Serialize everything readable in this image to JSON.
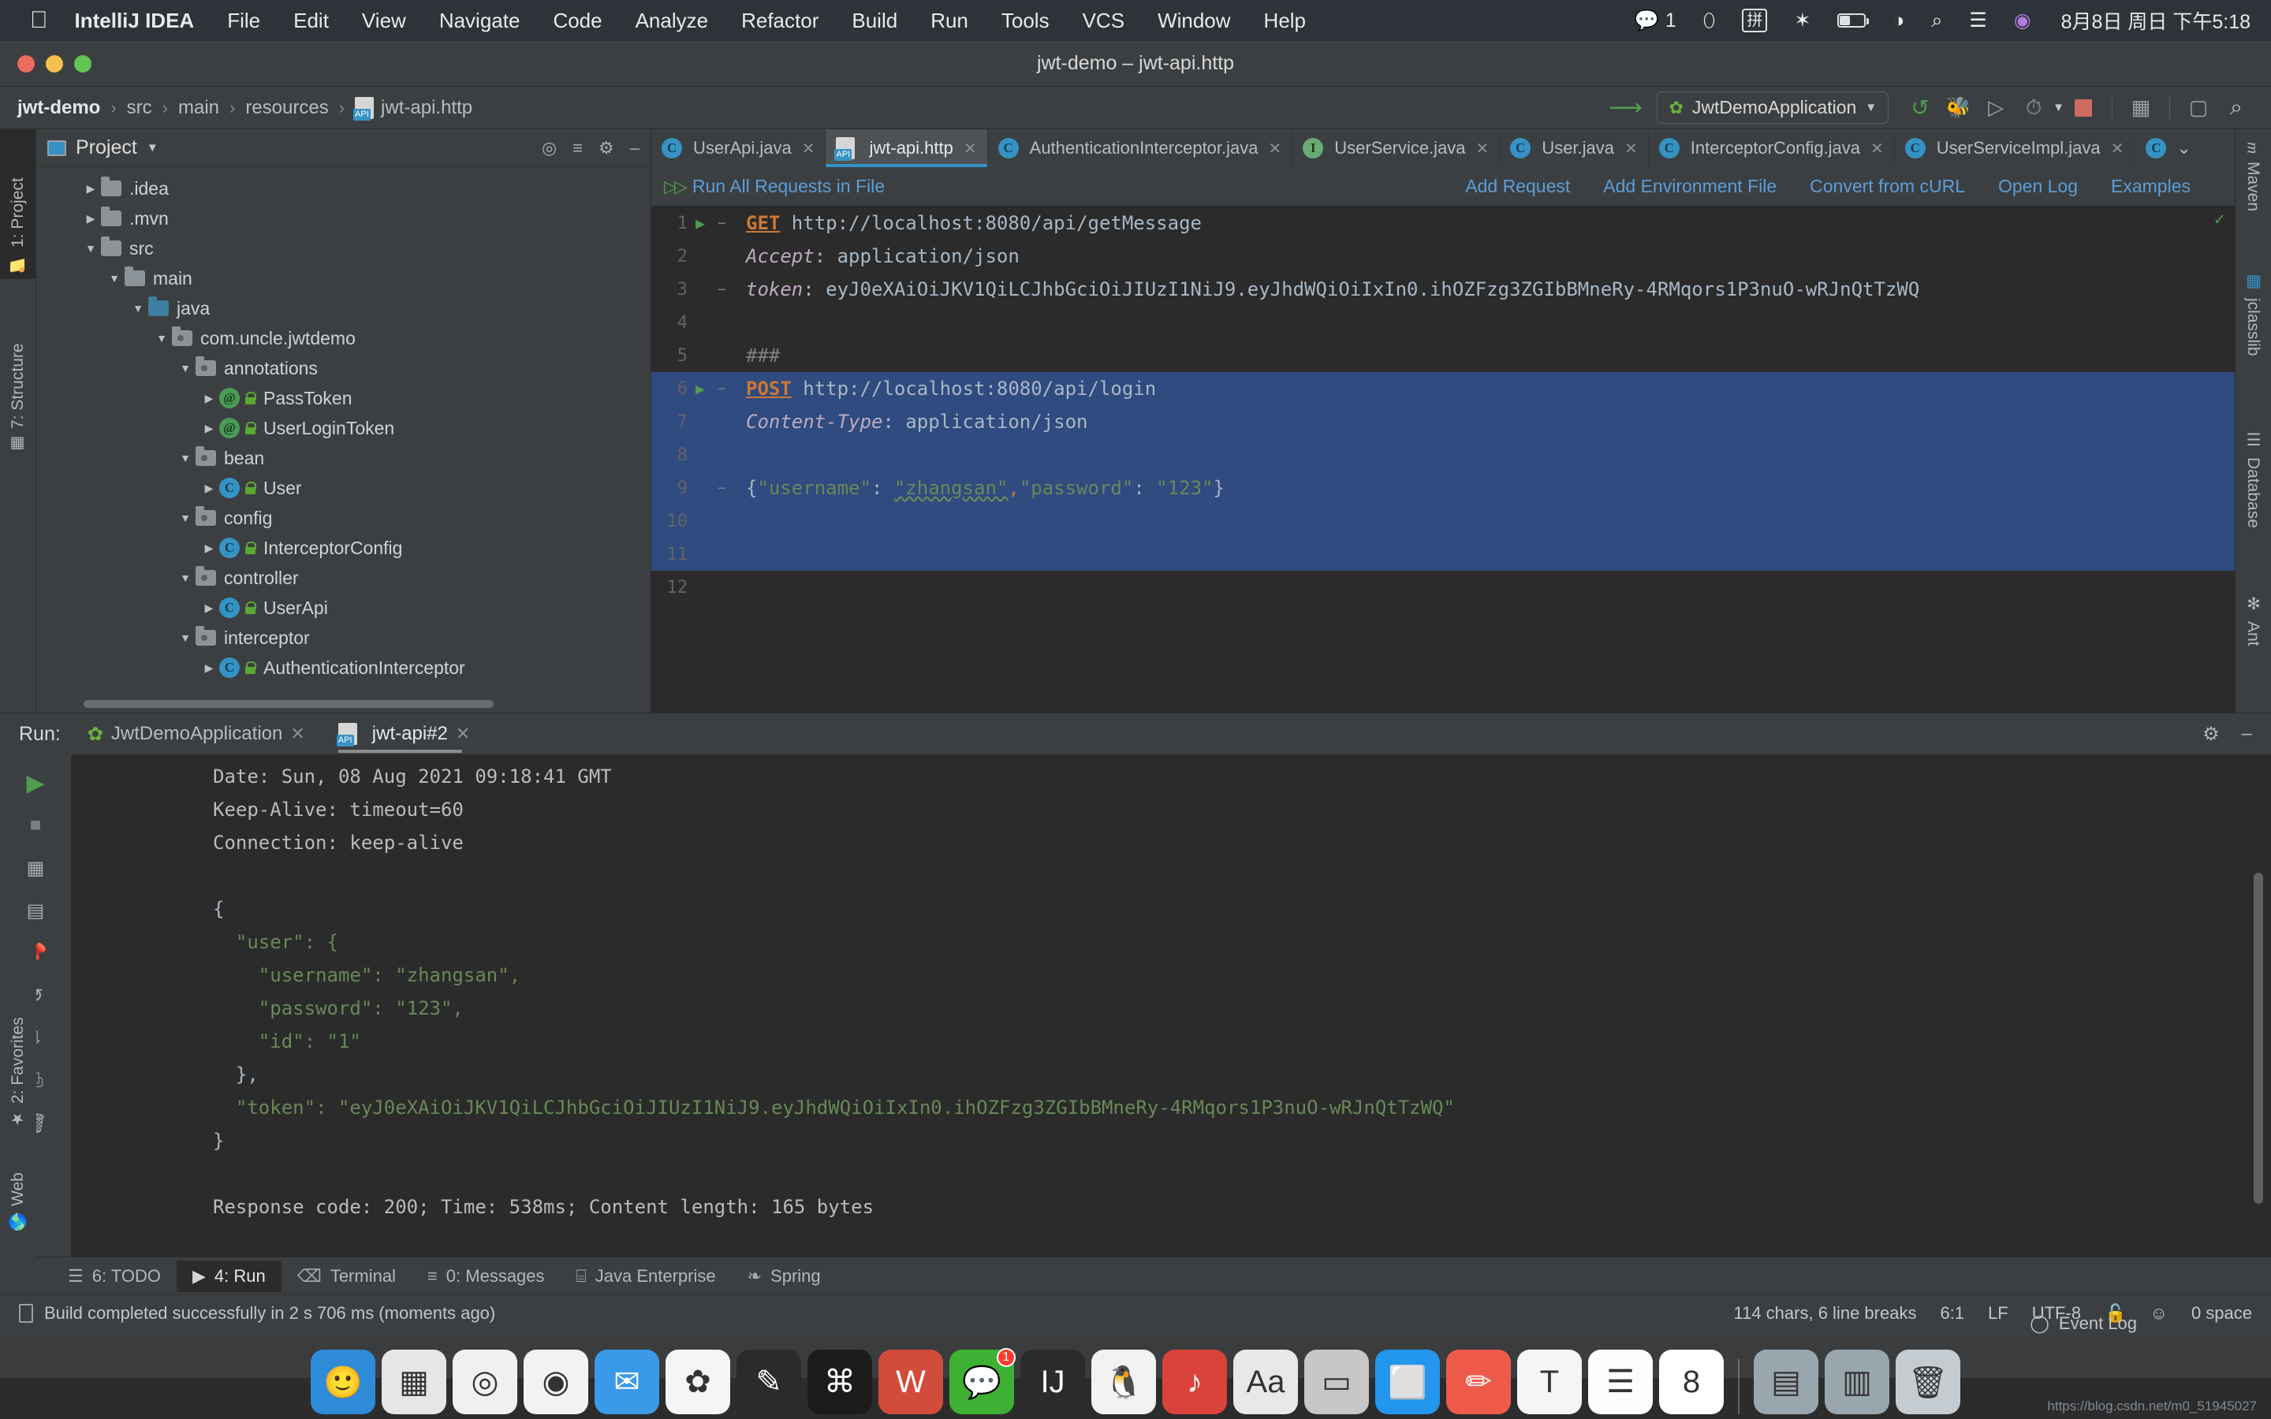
{
  "menubar": {
    "apple_icon": "apple-logo-icon",
    "items": [
      {
        "label": "IntelliJ IDEA",
        "bold": true
      },
      {
        "label": "File",
        "bold": false
      },
      {
        "label": "Edit",
        "bold": false
      },
      {
        "label": "View",
        "bold": false
      },
      {
        "label": "Navigate",
        "bold": false
      },
      {
        "label": "Code",
        "bold": false
      },
      {
        "label": "Analyze",
        "bold": false
      },
      {
        "label": "Refactor",
        "bold": false
      },
      {
        "label": "Build",
        "bold": false
      },
      {
        "label": "Run",
        "bold": false
      },
      {
        "label": "Tools",
        "bold": false
      },
      {
        "label": "VCS",
        "bold": false
      },
      {
        "label": "Window",
        "bold": false
      },
      {
        "label": "Help",
        "bold": false
      }
    ],
    "status_icons": [
      {
        "name": "wechat-icon",
        "glyph": "💬",
        "badge": "1"
      },
      {
        "name": "shield-icon",
        "glyph": "⬯"
      },
      {
        "name": "input-method-icon",
        "glyph": "拼"
      },
      {
        "name": "bluetooth-icon",
        "glyph": "✶"
      },
      {
        "name": "battery-icon",
        "glyph": ""
      },
      {
        "name": "wifi-icon",
        "glyph": "◔"
      },
      {
        "name": "search-icon",
        "glyph": "⌕"
      },
      {
        "name": "control-center-icon",
        "glyph": "☰"
      },
      {
        "name": "siri-icon",
        "glyph": "◉"
      }
    ],
    "clock": "8月8日 周日 下午5:18"
  },
  "window": {
    "title": "jwt-demo – jwt-api.http",
    "traffic_lights": [
      "close",
      "minimize",
      "zoom"
    ]
  },
  "navbar": {
    "breadcrumbs": [
      "jwt-demo",
      "src",
      "main",
      "resources",
      "jwt-api.http"
    ],
    "separator": "›",
    "run_config": "JwtDemoApplication",
    "toolbar_icons": [
      "back-arrow-icon",
      "rerun-icon",
      "debug-icon",
      "run-with-coverage-icon",
      "profiler-icon",
      "stop-icon",
      "build-project-icon",
      "open-terminal-icon",
      "search-everywhere-icon"
    ]
  },
  "left_strip": {
    "tabs": [
      {
        "label": "1: Project",
        "icon": "project-folder-icon",
        "active": true
      },
      {
        "label": "7: Structure",
        "icon": "structure-icon",
        "active": false
      },
      {
        "label": "2: Favorites",
        "icon": "star-icon",
        "active": false
      },
      {
        "label": "Web",
        "icon": "globe-icon",
        "active": false
      }
    ]
  },
  "right_strip": {
    "tabs": [
      {
        "label": "Maven",
        "icon": "maven-icon"
      },
      {
        "label": "jclasslib",
        "icon": "jclasslib-icon"
      },
      {
        "label": "Database",
        "icon": "database-icon"
      },
      {
        "label": "Ant",
        "icon": "ant-icon"
      }
    ]
  },
  "project_panel": {
    "title": "Project",
    "header_icons": [
      "locate-icon",
      "collapse-all-icon",
      "settings-gear-icon",
      "hide-icon"
    ],
    "tree": [
      {
        "label": ".idea",
        "indent": 1,
        "arrow": "▶",
        "kind": "folder"
      },
      {
        "label": ".mvn",
        "indent": 1,
        "arrow": "▶",
        "kind": "folder"
      },
      {
        "label": "src",
        "indent": 1,
        "arrow": "▼",
        "kind": "folder"
      },
      {
        "label": "main",
        "indent": 2,
        "arrow": "▼",
        "kind": "folder"
      },
      {
        "label": "java",
        "indent": 3,
        "arrow": "▼",
        "kind": "folder-source"
      },
      {
        "label": "com.uncle.jwtdemo",
        "indent": 4,
        "arrow": "▼",
        "kind": "package"
      },
      {
        "label": "annotations",
        "indent": 5,
        "arrow": "▼",
        "kind": "package"
      },
      {
        "label": "PassToken",
        "indent": 6,
        "arrow": "▶",
        "kind": "annotation"
      },
      {
        "label": "UserLoginToken",
        "indent": 6,
        "arrow": "▶",
        "kind": "annotation"
      },
      {
        "label": "bean",
        "indent": 5,
        "arrow": "▼",
        "kind": "package"
      },
      {
        "label": "User",
        "indent": 6,
        "arrow": "▶",
        "kind": "class"
      },
      {
        "label": "config",
        "indent": 5,
        "arrow": "▼",
        "kind": "package"
      },
      {
        "label": "InterceptorConfig",
        "indent": 6,
        "arrow": "▶",
        "kind": "class"
      },
      {
        "label": "controller",
        "indent": 5,
        "arrow": "▼",
        "kind": "package"
      },
      {
        "label": "UserApi",
        "indent": 6,
        "arrow": "▶",
        "kind": "class"
      },
      {
        "label": "interceptor",
        "indent": 5,
        "arrow": "▼",
        "kind": "package"
      },
      {
        "label": "AuthenticationInterceptor",
        "indent": 6,
        "arrow": "▶",
        "kind": "class"
      }
    ]
  },
  "editor": {
    "tabs": [
      {
        "label": "UserApi.java",
        "icon": "class-icon",
        "active": false
      },
      {
        "label": "jwt-api.http",
        "icon": "http-file-icon",
        "active": true
      },
      {
        "label": "AuthenticationInterceptor.java",
        "icon": "class-icon",
        "active": false
      },
      {
        "label": "UserService.java",
        "icon": "interface-icon",
        "active": false
      },
      {
        "label": "User.java",
        "icon": "class-icon",
        "active": false
      },
      {
        "label": "InterceptorConfig.java",
        "icon": "class-icon",
        "active": false
      },
      {
        "label": "UserServiceImpl.java",
        "icon": "class-icon",
        "active": false
      }
    ],
    "tab_overflow_icon": "chevron-down-icon",
    "http_toolbar": {
      "run_all": "Run All Requests in File",
      "links": [
        "Add Request",
        "Add Environment File",
        "Convert from cURL",
        "Open Log",
        "Examples"
      ]
    },
    "lines": [
      {
        "num": "1",
        "selected": false,
        "runmark": true,
        "fold": "−",
        "segments": [
          {
            "t": "GET",
            "c": "kw-method"
          },
          {
            "t": " http://localhost:8080/api/getMessage",
            "c": "punc"
          }
        ]
      },
      {
        "num": "2",
        "selected": false,
        "runmark": false,
        "fold": "",
        "segments": [
          {
            "t": "Accept",
            "c": "hdr-name"
          },
          {
            "t": ": application/json",
            "c": "punc"
          }
        ]
      },
      {
        "num": "3",
        "selected": false,
        "runmark": false,
        "fold": "−",
        "segments": [
          {
            "t": "token",
            "c": "hdr-name"
          },
          {
            "t": ": eyJ0eXAiOiJKV1QiLCJhbGciOiJIUzI1NiJ9.eyJhdWQiOiIxIn0.ihOZFzg3ZGIbBMneRy-4RMqors1P3nuO-wRJnQtTzWQ",
            "c": "punc"
          }
        ]
      },
      {
        "num": "4",
        "selected": false,
        "runmark": false,
        "fold": "",
        "segments": []
      },
      {
        "num": "5",
        "selected": false,
        "runmark": false,
        "fold": "",
        "segments": [
          {
            "t": "###",
            "c": "cmt"
          }
        ]
      },
      {
        "num": "6",
        "selected": true,
        "runmark": true,
        "fold": "−",
        "segments": [
          {
            "t": "POST",
            "c": "kw-method"
          },
          {
            "t": " http://localhost:8080/api/login",
            "c": "punc"
          }
        ]
      },
      {
        "num": "7",
        "selected": true,
        "runmark": false,
        "fold": "",
        "segments": [
          {
            "t": "Content-Type",
            "c": "hdr-name"
          },
          {
            "t": ": application/json",
            "c": "punc"
          }
        ]
      },
      {
        "num": "8",
        "selected": true,
        "runmark": false,
        "fold": "",
        "segments": []
      },
      {
        "num": "9",
        "selected": true,
        "runmark": false,
        "fold": "−",
        "segments": [
          {
            "t": "{",
            "c": "punc"
          },
          {
            "t": "\"username\"",
            "c": "str"
          },
          {
            "t": ": ",
            "c": "punc"
          },
          {
            "t": "\"zhangsan\"",
            "c": "strg squig"
          },
          {
            "t": ",",
            "c": "orange"
          },
          {
            "t": "\"password\"",
            "c": "str"
          },
          {
            "t": ": ",
            "c": "punc"
          },
          {
            "t": "\"123\"",
            "c": "strg"
          },
          {
            "t": "}",
            "c": "punc"
          }
        ]
      },
      {
        "num": "10",
        "selected": true,
        "runmark": false,
        "fold": "",
        "segments": []
      },
      {
        "num": "11",
        "selected": true,
        "runmark": false,
        "fold": "",
        "segments": []
      },
      {
        "num": "12",
        "selected": false,
        "runmark": false,
        "fold": "",
        "segments": []
      }
    ]
  },
  "run_panel": {
    "label": "Run:",
    "tabs": [
      {
        "label": "JwtDemoApplication",
        "icon": "spring-leaf-icon",
        "active": false
      },
      {
        "label": "jwt-api#2",
        "icon": "http-file-icon",
        "active": true
      }
    ],
    "header_icons": [
      "settings-gear-icon",
      "hide-icon"
    ],
    "tool_icons": [
      "rerun-icon",
      "stop-icon",
      "restore-layout-icon",
      "layout-icon",
      "pin-icon",
      "soft-wrap-icon",
      "scroll-to-end-icon",
      "print-icon",
      "clear-all-icon"
    ],
    "console": [
      {
        "text": "Date: Sun, 08 Aug 2021 09:18:41 GMT",
        "style": "plain"
      },
      {
        "text": "Keep-Alive: timeout=60",
        "style": "plain"
      },
      {
        "text": "Connection: keep-alive",
        "style": "plain"
      },
      {
        "text": "",
        "style": "plain"
      },
      {
        "text": "{",
        "style": "brace"
      },
      {
        "text": "  \"user\": {",
        "style": "key"
      },
      {
        "text": "    \"username\": \"zhangsan\",",
        "style": "key"
      },
      {
        "text": "    \"password\": \"123\",",
        "style": "key"
      },
      {
        "text": "    \"id\": \"1\"",
        "style": "key"
      },
      {
        "text": "  },",
        "style": "brace"
      },
      {
        "text": "  \"token\": \"eyJ0eXAiOiJKV1QiLCJhbGciOiJIUzI1NiJ9.eyJhdWQiOiIxIn0.ihOZFzg3ZGIbBMneRy-4RMqors1P3nuO-wRJnQtTzWQ\"",
        "style": "key"
      },
      {
        "text": "}",
        "style": "brace"
      },
      {
        "text": "",
        "style": "plain"
      },
      {
        "text": "Response code: 200; Time: 538ms; Content length: 165 bytes",
        "style": "plain"
      }
    ]
  },
  "bottom_bar": {
    "tabs": [
      {
        "label": "6: TODO",
        "icon": "todo-icon",
        "active": false
      },
      {
        "label": "4: Run",
        "icon": "run-triangle-icon",
        "active": true
      },
      {
        "label": "Terminal",
        "icon": "terminal-icon",
        "active": false
      },
      {
        "label": "0: Messages",
        "icon": "messages-icon",
        "active": false
      },
      {
        "label": "Java Enterprise",
        "icon": "java-enterprise-icon",
        "active": false
      },
      {
        "label": "Spring",
        "icon": "spring-leaf-icon",
        "active": false
      }
    ],
    "event_log": "Event Log",
    "event_log_icon": "event-log-icon"
  },
  "status_bar": {
    "message": "Build completed successfully in 2 s 706 ms (moments ago)",
    "message_icon": "build-icon",
    "chars": "114 chars, 6 line breaks",
    "caret": "6:1",
    "line_sep": "LF",
    "encoding": "UTF-8",
    "lock_icon": "unlocked-icon",
    "inspection_icon": "hector-icon",
    "indent": "0 space"
  },
  "dock": {
    "items": [
      {
        "name": "finder-icon",
        "glyph": "🙂",
        "bg": "#2d8bd8"
      },
      {
        "name": "launchpad-icon",
        "glyph": "▦",
        "bg": "#e6e6e6"
      },
      {
        "name": "safari-icon",
        "glyph": "◎",
        "bg": "#f0f0f0"
      },
      {
        "name": "chrome-icon",
        "glyph": "◉",
        "bg": "#f2f2f2"
      },
      {
        "name": "mail-icon",
        "glyph": "✉",
        "bg": "#3a9ae8"
      },
      {
        "name": "photos-icon",
        "glyph": "✿",
        "bg": "#f5f5f5"
      },
      {
        "name": "sketch-icon",
        "glyph": "✎",
        "bg": "#2b2b2b"
      },
      {
        "name": "terminal-icon",
        "glyph": "⌘",
        "bg": "#1c1c1c"
      },
      {
        "name": "wps-icon",
        "glyph": "W",
        "bg": "#d24c3c"
      },
      {
        "name": "wechat-icon",
        "glyph": "💬",
        "bg": "#3eb034",
        "badge": "1"
      },
      {
        "name": "intellij-idea-icon",
        "glyph": "IJ",
        "bg": "#2b2b2b"
      },
      {
        "name": "qq-icon",
        "glyph": "🐧",
        "bg": "#f2f2f2"
      },
      {
        "name": "wangyi-music-icon",
        "glyph": "♪",
        "bg": "#d9433a"
      },
      {
        "name": "dictionary-icon",
        "glyph": "Aa",
        "bg": "#e8e8e8"
      },
      {
        "name": "display-icon",
        "glyph": "▭",
        "bg": "#c7c7c7"
      },
      {
        "name": "docker-icon",
        "glyph": "⬜",
        "bg": "#2396ed"
      },
      {
        "name": "marker-icon",
        "glyph": "✏",
        "bg": "#ef5b4a"
      },
      {
        "name": "typora-icon",
        "glyph": "T",
        "bg": "#f5f5f5"
      },
      {
        "name": "notes-icon",
        "glyph": "☰",
        "bg": "#fdfdfd"
      },
      {
        "name": "calendar-icon",
        "glyph": "8",
        "bg": "#ffffff"
      },
      {
        "name": "downloads-stack-icon",
        "glyph": "▤",
        "bg": "#9aa6ad"
      },
      {
        "name": "documents-stack-icon",
        "glyph": "▥",
        "bg": "#9aa6ad"
      },
      {
        "name": "trash-icon",
        "glyph": "🗑",
        "bg": "#c5ccd1"
      }
    ]
  },
  "watermark": "https://blog.csdn.net/m0_51945027"
}
